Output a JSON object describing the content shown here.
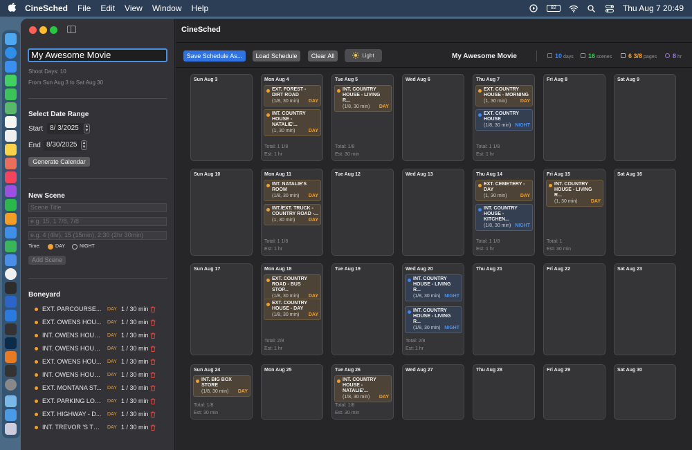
{
  "menubar": {
    "app": "CineSched",
    "items": [
      "File",
      "Edit",
      "View",
      "Window",
      "Help"
    ],
    "clock": "Thu Aug 7  20:49",
    "battery": "82"
  },
  "window_title": "CineSched",
  "sidebar": {
    "project_title": "My Awesome Movie",
    "shoot_days": "Shoot Days: 10",
    "range_text": "From Sun Aug 3 to Sat Aug 30",
    "date_range_heading": "Select Date Range",
    "start_label": "Start",
    "start_value": "8/  3/2025",
    "end_label": "End",
    "end_value": "8/30/2025",
    "generate_button": "Generate Calendar",
    "new_scene_heading": "New Scene",
    "scene_title_placeholder": "Scene Title",
    "pages_placeholder": "e.g. 15, 1 7/8, 7/8",
    "duration_placeholder": "e.g. 4 (4hr), 15 (15min), 2:30 (2hr 30min)",
    "time_label": "Time:",
    "day_option": "DAY",
    "night_option": "NIGHT",
    "add_scene_button": "Add Scene",
    "boneyard_heading": "Boneyard",
    "boneyard": [
      {
        "title": "EXT. PARCOURSE...",
        "tod": "DAY",
        "val": "1 / 30 min"
      },
      {
        "title": "EXT. OWENS HOU...",
        "tod": "DAY",
        "val": "1 / 30 min"
      },
      {
        "title": "INT. OWENS HOUS...",
        "tod": "DAY",
        "val": "1 / 30 min"
      },
      {
        "title": "INT. OWENS HOUS...",
        "tod": "DAY",
        "val": "1 / 30 min"
      },
      {
        "title": "EXT. OWENS HOU...",
        "tod": "DAY",
        "val": "1 / 30 min"
      },
      {
        "title": "INT. OWENS HOUS...",
        "tod": "DAY",
        "val": "1 / 30 min"
      },
      {
        "title": "EXT. MONTANA ST...",
        "tod": "DAY",
        "val": "1 / 30 min"
      },
      {
        "title": "EXT. PARKING LOT...",
        "tod": "DAY",
        "val": "1 / 30 min"
      },
      {
        "title": "EXT. HIGHWAY - D...",
        "tod": "DAY",
        "val": "1 / 30 min"
      },
      {
        "title": "INT. TREVOR 'S TR...",
        "tod": "DAY",
        "val": "1 / 30 min"
      }
    ]
  },
  "toolbar": {
    "save": "Save Schedule As...",
    "load": "Load Schedule",
    "clear": "Clear All",
    "light": "Light",
    "project_name": "My Awesome Movie",
    "stats": {
      "days_val": "10",
      "days_unit": "days",
      "days_color": "#3d86f5",
      "scenes_val": "16",
      "scenes_unit": "scenes",
      "scenes_color": "#3ec95a",
      "pages_val": "6 3/8",
      "pages_unit": "pages",
      "pages_color": "#f0a030",
      "hours_val": "8",
      "hours_unit": "hr",
      "hours_color": "#a070f0"
    }
  },
  "calendar": {
    "weeks": [
      [
        {
          "label": "Sun Aug 3",
          "scenes": [],
          "total": "",
          "est": ""
        },
        {
          "label": "Mon Aug 4",
          "scenes": [
            {
              "title": "EXT. FOREST - DIRT ROAD",
              "meta": "(1/8, 30 min)",
              "tod": "DAY"
            },
            {
              "title": "INT. COUNTRY HOUSE - NATALIE'...",
              "meta": "(1, 30 min)",
              "tod": "DAY"
            }
          ],
          "total": "Total: 1 1/8",
          "est": "Est: 1 hr"
        },
        {
          "label": "Tue Aug 5",
          "scenes": [
            {
              "title": "INT. COUNTRY HOUSE - LIVING R...",
              "meta": "(1/8, 30 min)",
              "tod": "DAY"
            }
          ],
          "total": "Total: 1/8",
          "est": "Est: 30 min"
        },
        {
          "label": "Wed Aug 6",
          "scenes": [],
          "total": "",
          "est": ""
        },
        {
          "label": "Thu Aug 7",
          "scenes": [
            {
              "title": "EXT. COUNTRY HOUSE - MORNING",
              "meta": "(1, 30 min)",
              "tod": "DAY"
            },
            {
              "title": "EXT. COUNTRY HOUSE",
              "meta": "(1/8, 30 min)",
              "tod": "NIGHT"
            }
          ],
          "total": "Total: 1 1/8",
          "est": "Est: 1 hr"
        },
        {
          "label": "Fri Aug 8",
          "scenes": [],
          "total": "",
          "est": ""
        },
        {
          "label": "Sat Aug 9",
          "scenes": [],
          "total": "",
          "est": ""
        }
      ],
      [
        {
          "label": "Sun Aug 10",
          "scenes": [],
          "total": "",
          "est": ""
        },
        {
          "label": "Mon Aug 11",
          "scenes": [
            {
              "title": "INT. NATALIE'S ROOM",
              "meta": "(1/8, 30 min)",
              "tod": "DAY"
            },
            {
              "title": "INT./EXT. TRUCK - COUNTRY ROAD -...",
              "meta": "(1, 30 min)",
              "tod": "DAY"
            }
          ],
          "total": "Total: 1 1/8",
          "est": "Est: 1 hr"
        },
        {
          "label": "Tue Aug 12",
          "scenes": [],
          "total": "",
          "est": ""
        },
        {
          "label": "Wed Aug 13",
          "scenes": [],
          "total": "",
          "est": ""
        },
        {
          "label": "Thu Aug 14",
          "scenes": [
            {
              "title": "EXT. CEMETERY - DAY",
              "meta": "(1, 30 min)",
              "tod": "DAY"
            },
            {
              "title": "INT. COUNTRY HOUSE - KITCHEN...",
              "meta": "(1/8, 30 min)",
              "tod": "NIGHT"
            }
          ],
          "total": "Total: 1 1/8",
          "est": "Est: 1 hr"
        },
        {
          "label": "Fri Aug 15",
          "scenes": [
            {
              "title": "INT. COUNTRY HOUSE - LIVING R...",
              "meta": "(1, 30 min)",
              "tod": "DAY"
            }
          ],
          "total": "Total: 1",
          "est": "Est: 30 min"
        },
        {
          "label": "Sat Aug 16",
          "scenes": [],
          "total": "",
          "est": ""
        }
      ],
      [
        {
          "label": "Sun Aug 17",
          "scenes": [],
          "total": "",
          "est": ""
        },
        {
          "label": "Mon Aug 18",
          "scenes": [
            {
              "title": "EXT. COUNTRY ROAD - BUS STOP...",
              "meta": "(1/8, 30 min)",
              "tod": "DAY"
            },
            {
              "title": "EXT. COUNTRY HOUSE - DAY",
              "meta": "(1/8, 30 min)",
              "tod": "DAY"
            }
          ],
          "total": "Total: 2/8",
          "est": "Est: 1 hr"
        },
        {
          "label": "Tue Aug 19",
          "scenes": [],
          "total": "",
          "est": ""
        },
        {
          "label": "Wed Aug 20",
          "scenes": [
            {
              "title": "INT. COUNTRY HOUSE - LIVING R...",
              "meta": "(1/8, 30 min)",
              "tod": "NIGHT"
            },
            {
              "title": "INT. COUNTRY HOUSE - LIVING R...",
              "meta": "(1/8, 30 min)",
              "tod": "NIGHT"
            }
          ],
          "total": "Total: 2/8",
          "est": "Est: 1 hr"
        },
        {
          "label": "Thu Aug 21",
          "scenes": [],
          "total": "",
          "est": ""
        },
        {
          "label": "Fri Aug 22",
          "scenes": [],
          "total": "",
          "est": ""
        },
        {
          "label": "Sat Aug 23",
          "scenes": [],
          "total": "",
          "est": ""
        }
      ],
      [
        {
          "label": "Sun Aug 24",
          "scenes": [
            {
              "title": "INT. BIG BOX STORE",
              "meta": "(1/8, 30 min)",
              "tod": "DAY"
            }
          ],
          "total": "Total: 1/8",
          "est": "Est: 30 min"
        },
        {
          "label": "Mon Aug 25",
          "scenes": [],
          "total": "",
          "est": ""
        },
        {
          "label": "Tue Aug 26",
          "scenes": [
            {
              "title": "INT. COUNTRY HOUSE - NATALIE'...",
              "meta": "(1/8, 30 min)",
              "tod": "DAY"
            }
          ],
          "total": "Total: 1/8",
          "est": "Est: 30 min"
        },
        {
          "label": "Wed Aug 27",
          "scenes": [],
          "total": "",
          "est": ""
        },
        {
          "label": "Thu Aug 28",
          "scenes": [],
          "total": "",
          "est": ""
        },
        {
          "label": "Fri Aug 29",
          "scenes": [],
          "total": "",
          "est": ""
        },
        {
          "label": "Sat Aug 30",
          "scenes": [],
          "total": "",
          "est": ""
        }
      ]
    ]
  }
}
